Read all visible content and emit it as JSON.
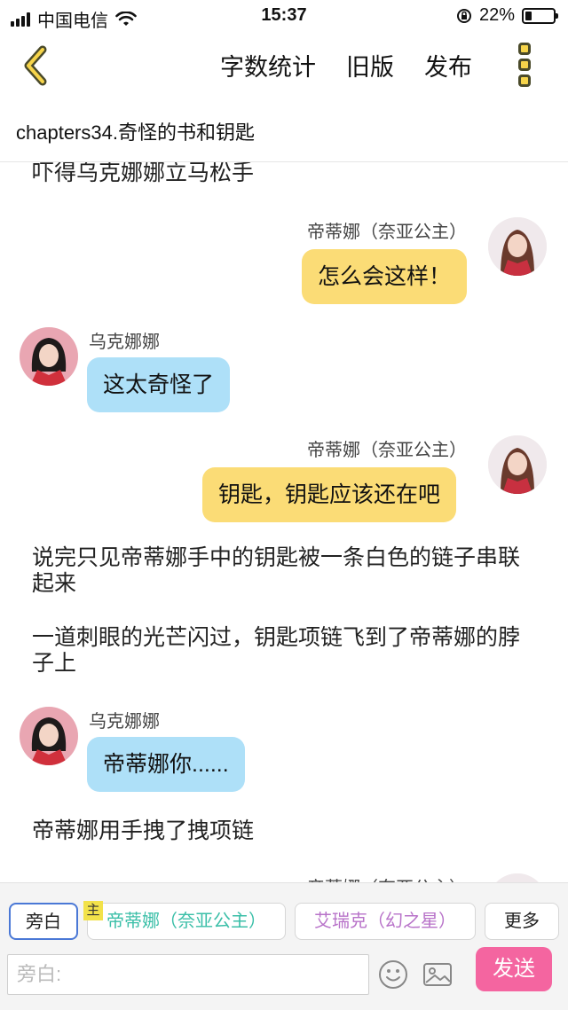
{
  "status_bar": {
    "carrier": "中国电信",
    "time": "15:37",
    "battery": "22%",
    "battery_level": 0.22
  },
  "nav": {
    "word_count": "字数统计",
    "old_version": "旧版",
    "publish": "发布"
  },
  "chapter_title": "chapters34.奇怪的书和钥匙",
  "messages": {
    "m0": "吓得乌克娜娜立马松手",
    "m1_speaker": "帝蒂娜（奈亚公主）",
    "m1_text": "怎么会这样！",
    "m2_speaker": "乌克娜娜",
    "m2_text": "这太奇怪了",
    "m3_speaker": "帝蒂娜（奈亚公主）",
    "m3_text": "钥匙，钥匙应该还在吧",
    "m4": "说完只见帝蒂娜手中的钥匙被一条白色的链子串联起来",
    "m5": "一道刺眼的光芒闪过，钥匙项链飞到了帝蒂娜的脖子上",
    "m6_speaker": "乌克娜娜",
    "m6_text": "帝蒂娜你......",
    "m7": "帝蒂娜用手拽了拽项链",
    "m8_speaker": "帝蒂娜（奈亚公主）"
  },
  "composer": {
    "narration_role": "旁白",
    "main_badge": "主",
    "role1": "帝蒂娜（奈亚公主）",
    "role2": "艾瑞克（幻之星）",
    "more": "更多",
    "input_placeholder": "旁白:",
    "send": "发送"
  },
  "colors": {
    "right_bubble": "#fbdc76",
    "left_bubble": "#aee0f8",
    "send": "#f465a0",
    "role1_text": "#3bbfa8",
    "role2_text": "#b873c9"
  }
}
